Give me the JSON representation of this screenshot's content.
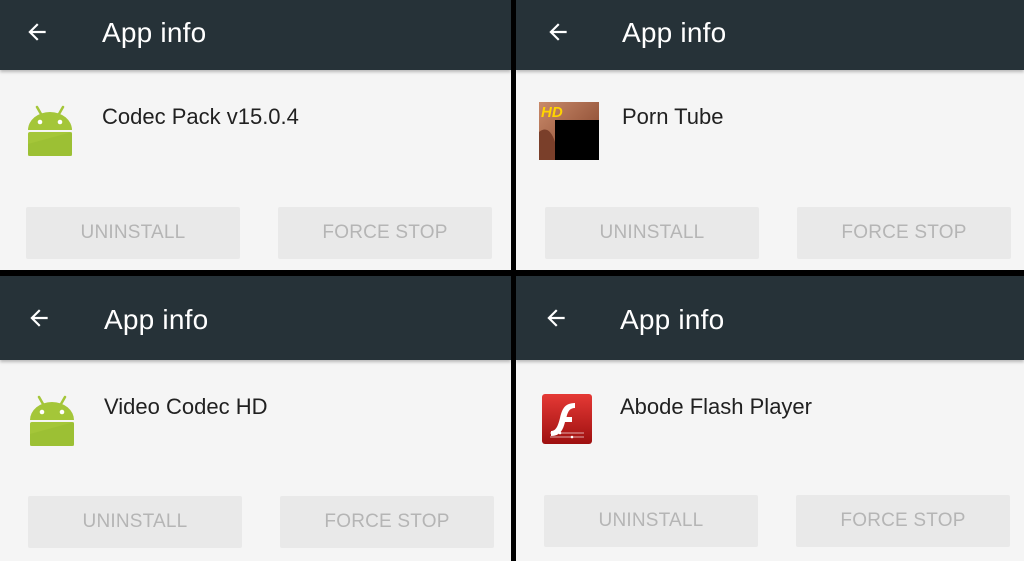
{
  "colors": {
    "toolbar": "#263238",
    "panel_background": "#f5f5f5",
    "button_background": "#e9e9e9",
    "button_text_disabled": "#b5b5b5",
    "android_green": "#a4c639",
    "flash_red": "#c62828"
  },
  "panels": [
    {
      "title": "App info",
      "app_name": "Codec Pack v15.0.4",
      "icon": "android-robot-icon",
      "buttons": {
        "uninstall": "UNINSTALL",
        "force_stop": "FORCE STOP"
      }
    },
    {
      "title": "App info",
      "app_name": "Porn Tube",
      "icon": "hd-thumbnail-icon",
      "icon_badge": "HD",
      "buttons": {
        "uninstall": "UNINSTALL",
        "force_stop": "FORCE STOP"
      }
    },
    {
      "title": "App info",
      "app_name": "Video Codec HD",
      "icon": "android-robot-icon",
      "buttons": {
        "uninstall": "UNINSTALL",
        "force_stop": "FORCE STOP"
      }
    },
    {
      "title": "App info",
      "app_name": "Abode Flash Player",
      "icon": "flash-player-icon",
      "buttons": {
        "uninstall": "UNINSTALL",
        "force_stop": "FORCE STOP"
      }
    }
  ]
}
